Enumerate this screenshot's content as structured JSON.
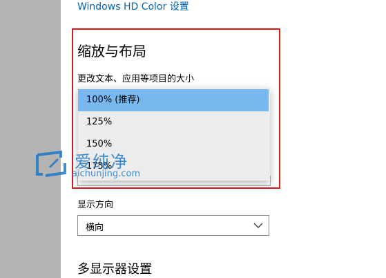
{
  "settings": {
    "hd_color_link": "Windows HD Color 设置",
    "section_title": "缩放与布局",
    "scale_label": "更改文本、应用等项目的大小",
    "scale_options": [
      "100% (推荐)",
      "125%",
      "150%",
      "175%"
    ],
    "scale_selected": "100% (推荐)",
    "orientation_label": "显示方向",
    "orientation_value": "横向",
    "multi_display_title": "多显示器设置"
  },
  "watermark": {
    "text": "爱纯净",
    "url": "aichunjing.com"
  },
  "colors": {
    "highlight_border": "#d61a1a",
    "selected_option": "#79b8ef",
    "link": "#0063b1",
    "left_rail": "#b4b4b4",
    "watermark": "#1d78c7"
  },
  "icons": {
    "chevron": "chevron-down-icon",
    "watermark_logo": "watermark-logo-icon"
  }
}
